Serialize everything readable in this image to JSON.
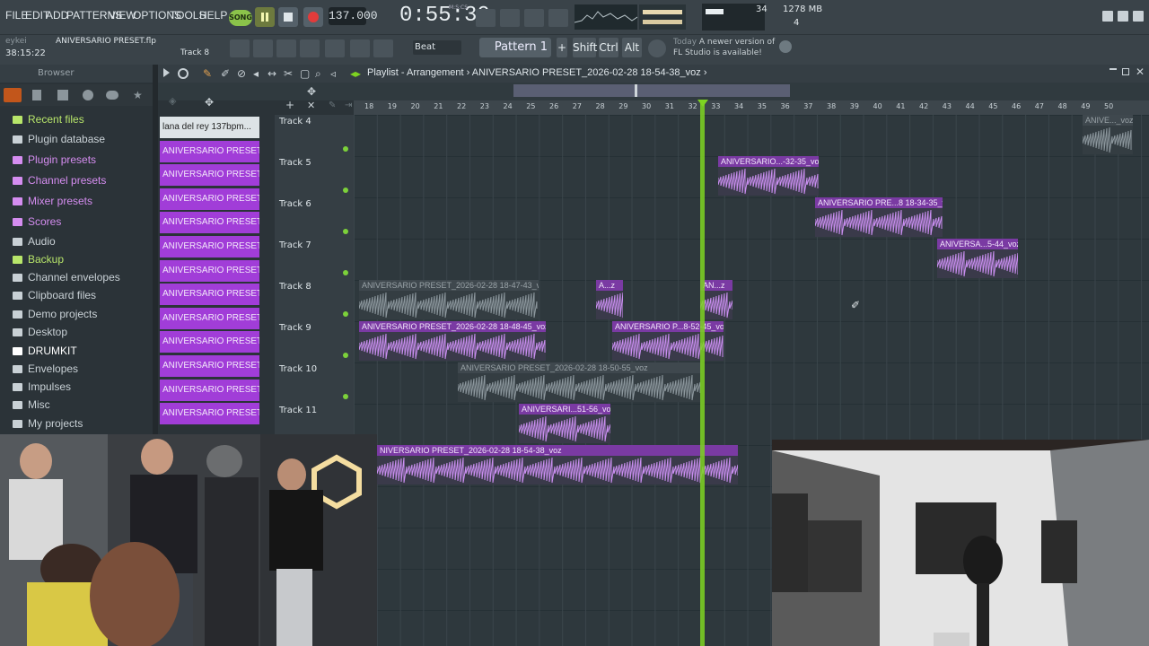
{
  "menu": [
    "FILE",
    "EDIT",
    "ADD",
    "PATTERNS",
    "VIEW",
    "OPTIONS",
    "TOOLS",
    "HELP"
  ],
  "transport": {
    "song_mode": "SONG",
    "tempo": "137.000",
    "time": "0:55:30",
    "time_unit": "M:S:CS"
  },
  "monitor": {
    "cpu": "34",
    "memory": "1278 MB",
    "polyphony": "4"
  },
  "project": {
    "user": "eykei",
    "file": "ANIVERSARIO PRESET.flp",
    "track": "Track 8",
    "clock": "38:15:22"
  },
  "toolbar": {
    "snap": "Beat",
    "pattern": "Pattern 1",
    "shift": "Shift",
    "ctrl": "Ctrl",
    "alt": "Alt"
  },
  "news": {
    "label": "Today",
    "line1": "A newer version of",
    "line2": "FL Studio is available!"
  },
  "browser": {
    "title": "Browser",
    "items": [
      {
        "label": "Recent files",
        "color": "#b8e66a"
      },
      {
        "label": "Plugin database",
        "color": "#c9d1d6"
      },
      {
        "label": "Plugin presets",
        "color": "#d58df0"
      },
      {
        "label": "Channel presets",
        "color": "#d58df0"
      },
      {
        "label": "Mixer presets",
        "color": "#d58df0"
      },
      {
        "label": "Scores",
        "color": "#d58df0"
      },
      {
        "label": "Audio",
        "color": "#c9d1d6"
      },
      {
        "label": "Backup",
        "color": "#b8e66a"
      },
      {
        "label": "Channel envelopes",
        "color": "#c9d1d6"
      },
      {
        "label": "Clipboard files",
        "color": "#c9d1d6"
      },
      {
        "label": "Demo projects",
        "color": "#c9d1d6"
      },
      {
        "label": "Desktop",
        "color": "#c9d1d6"
      },
      {
        "label": "DRUMKIT",
        "color": "#ffffff"
      },
      {
        "label": "Envelopes",
        "color": "#c9d1d6"
      },
      {
        "label": "Impulses",
        "color": "#c9d1d6"
      },
      {
        "label": "Misc",
        "color": "#c9d1d6"
      },
      {
        "label": "My projects",
        "color": "#c9d1d6"
      }
    ]
  },
  "playlist": {
    "title": "Playlist - Arrangement",
    "arrangement": "ANIVERSARIO PRESET_2026-02-28 18-54-38_voz",
    "channels": [
      "lana del rey 137bpm...",
      "ANIVERSARIO PRESET_202...",
      "ANIVERSARIO PRESET_202...",
      "ANIVERSARIO PRESET_202...",
      "ANIVERSARIO PRESET_202...",
      "ANIVERSARIO PRESET_202...",
      "ANIVERSARIO PRESET_202...",
      "ANIVERSARIO PRESET_202...",
      "ANIVERSARIO PRESET_202...",
      "ANIVERSARIO PRESET_202...",
      "ANIVERSARIO PRESET_202...",
      "ANIVERSARIO PRESET_202...",
      "ANIVERSARIO PRESET_202..."
    ],
    "ruler": [
      "18",
      "19",
      "20",
      "21",
      "22",
      "23",
      "24",
      "25",
      "26",
      "27",
      "28",
      "29",
      "30",
      "31",
      "32",
      "33",
      "34",
      "35",
      "36",
      "37",
      "38",
      "39",
      "40",
      "41",
      "42",
      "43",
      "44",
      "45",
      "46",
      "47",
      "48",
      "49",
      "50"
    ],
    "tracks": [
      "Track 4",
      "Track 5",
      "Track 6",
      "Track 7",
      "Track 8",
      "Track 9",
      "Track 10",
      "Track 11"
    ],
    "clips": [
      {
        "label": "ANIVE..._voz",
        "state": "off"
      },
      {
        "label": "ANIVERSARIO...-32-35_voz",
        "state": "on"
      },
      {
        "label": "ANIVERSARIO PRE...8 18-34-35_voz",
        "state": "on"
      },
      {
        "label": "ANIVERSA...5-44_voz",
        "state": "on"
      },
      {
        "label": "ANIVERSARIO PRESET_2026-02-28 18-47-43_voz",
        "state": "off"
      },
      {
        "label": "A...z",
        "state": "on"
      },
      {
        "label": "AN...z",
        "state": "on"
      },
      {
        "label": "ANIVERSARIO PRESET_2026-02-28 18-48-45_voz",
        "state": "on"
      },
      {
        "label": "ANIVERSARIO P...8-52-45_voz",
        "state": "on"
      },
      {
        "label": "ANIVERSARIO PRESET_2026-02-28 18-50-55_voz",
        "state": "off"
      },
      {
        "label": "ANIVERSARI...51-56_voz",
        "state": "on"
      },
      {
        "label": "NIVERSARIO PRESET_2026-02-28 18-54-38_voz",
        "state": "on"
      }
    ]
  }
}
